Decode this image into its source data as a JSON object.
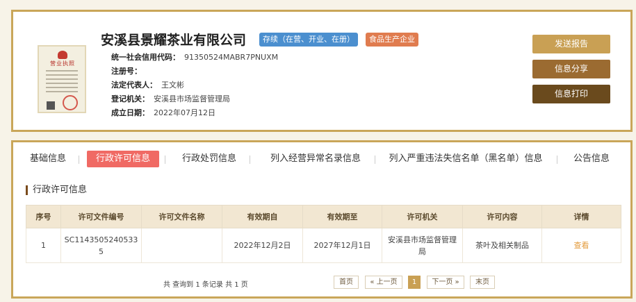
{
  "company": {
    "name": "安溪县景耀茶业有限公司",
    "status_tag": "存续（在营、开业、在册）",
    "type_tag": "食品生产企业",
    "license_image_text": "营业执照",
    "fields": [
      {
        "label": "统一社会信用代码：",
        "value": "91350524MABR7PNUXM"
      },
      {
        "label": "注册号：",
        "value": ""
      },
      {
        "label": "法定代表人：",
        "value": "王文彬"
      },
      {
        "label": "登记机关：",
        "value": "安溪县市场监督管理局"
      },
      {
        "label": "成立日期：",
        "value": "2022年07月12日"
      }
    ]
  },
  "actions": {
    "send_report": "发送报告",
    "share_info": "信息分享",
    "print_info": "信息打印"
  },
  "tabs": [
    {
      "label": "基础信息",
      "active": false
    },
    {
      "label": "行政许可信息",
      "active": true
    },
    {
      "label": "行政处罚信息",
      "active": false
    },
    {
      "label": "列入经营异常名录信息",
      "active": false
    },
    {
      "label": "列入严重违法失信名单（黑名单）信息",
      "active": false
    },
    {
      "label": "公告信息",
      "active": false
    }
  ],
  "section_title": "行政许可信息",
  "table": {
    "headers": [
      "序号",
      "许可文件编号",
      "许可文件名称",
      "有效期自",
      "有效期至",
      "许可机关",
      "许可内容",
      "详情"
    ],
    "rows": [
      [
        "1",
        "SC11435052405335",
        "",
        "2022年12月2日",
        "2027年12月1日",
        "安溪县市场监督管理局",
        "茶叶及相关制品",
        "查看"
      ]
    ]
  },
  "pagination": {
    "summary": "共 查询到 1 条记录 共 1 页",
    "first": "首页",
    "prev": "« 上一页",
    "current": "1",
    "next": "下一页 »",
    "last": "末页"
  },
  "colors": {
    "frame": "#c9a659",
    "active_tab": "#f06a64",
    "status_tag": "#4b8fcf",
    "type_tag": "#e07c4f",
    "btn_send": "#c9a054",
    "btn_share": "#9b6b31",
    "btn_print": "#6a4a1d",
    "link": "#e39b3c"
  }
}
